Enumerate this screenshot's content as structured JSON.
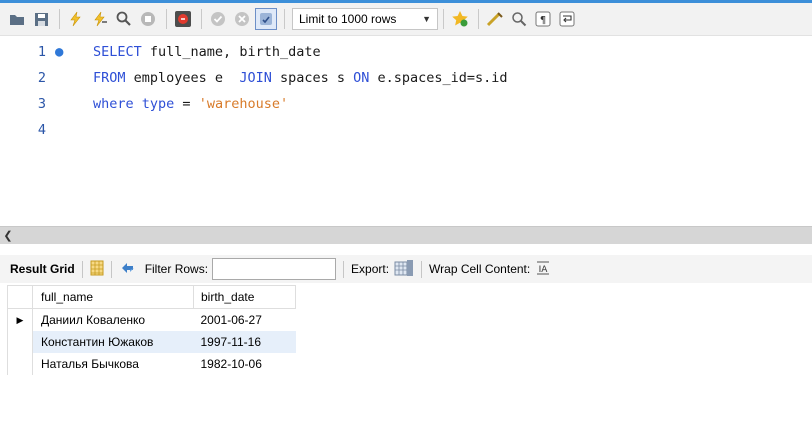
{
  "toolbar": {
    "limit_label": "Limit to 1000 rows",
    "icons": [
      "open-folder-icon",
      "save-icon",
      "execute-icon",
      "execute-current-icon",
      "explain-icon",
      "stop-icon",
      "toggle-error-icon",
      "commit-icon",
      "rollback-icon",
      "autocommit-icon",
      "star-icon",
      "beautify-icon",
      "find-icon",
      "invisibles-icon",
      "wrap-icon"
    ]
  },
  "editor": {
    "lines": [
      {
        "num": "1",
        "parts": [
          {
            "t": "SELECT",
            "kw": true
          },
          {
            "t": " full_name, birth_date"
          }
        ]
      },
      {
        "num": "2",
        "parts": [
          {
            "t": "FROM",
            "kw": true
          },
          {
            "t": " employees e  "
          },
          {
            "t": "JOIN",
            "kw": true
          },
          {
            "t": " spaces s "
          },
          {
            "t": "ON",
            "kw": true
          },
          {
            "t": " e.spaces_id=s.id"
          }
        ]
      },
      {
        "num": "3",
        "parts": [
          {
            "t": "where",
            "kw": true
          },
          {
            "t": " "
          },
          {
            "t": "type",
            "kw": true
          },
          {
            "t": " = "
          },
          {
            "t": "'warehouse'",
            "str": true
          }
        ]
      },
      {
        "num": "4",
        "parts": []
      }
    ]
  },
  "results_toolbar": {
    "result_grid": "Result Grid",
    "filter_rows": "Filter Rows:",
    "filter_value": "",
    "export": "Export:",
    "wrap": "Wrap Cell Content:"
  },
  "grid": {
    "columns": [
      "full_name",
      "birth_date"
    ],
    "rows": [
      [
        "Даниил Коваленко",
        "2001-06-27"
      ],
      [
        "Константин Южаков",
        "1997-11-16"
      ],
      [
        "Наталья Бычкова",
        "1982-10-06"
      ]
    ]
  }
}
